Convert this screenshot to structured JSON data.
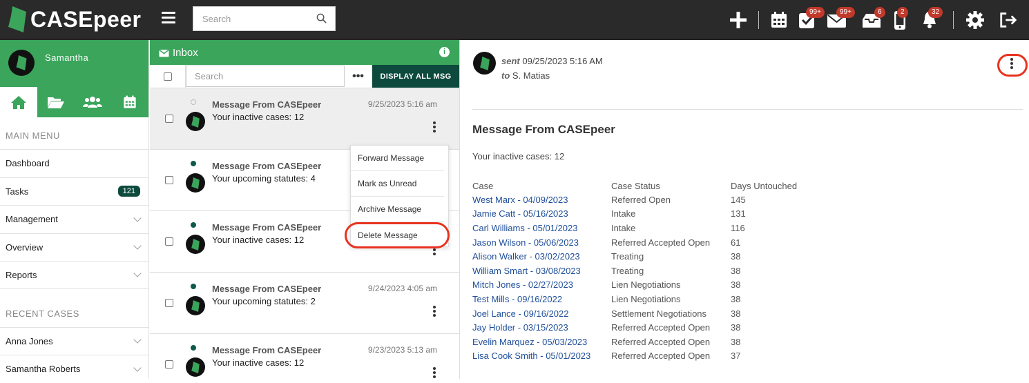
{
  "app": {
    "name": "CASEpeer"
  },
  "search": {
    "placeholder": "Search"
  },
  "topbar": {
    "badges": {
      "tasks": "99+",
      "mail": "99+",
      "inbox": "6",
      "mobile": "2",
      "notifications": "32"
    }
  },
  "sidebar": {
    "user": "Samantha",
    "main_menu_title": "MAIN MENU",
    "items": [
      {
        "label": "Dashboard"
      },
      {
        "label": "Tasks",
        "count": "121"
      },
      {
        "label": "Management"
      },
      {
        "label": "Overview"
      },
      {
        "label": "Reports"
      }
    ],
    "recent_title": "RECENT CASES",
    "recent": [
      {
        "label": "Anna Jones"
      },
      {
        "label": "Samantha Roberts"
      }
    ]
  },
  "inbox": {
    "title": "Inbox",
    "search_placeholder": "Search",
    "more": "•••",
    "display_all": "DISPLAY ALL MSG",
    "messages": [
      {
        "from": "Message From CASEpeer",
        "text": "Your inactive cases: 12",
        "date": "9/25/2023 5:16 am"
      },
      {
        "from": "Message From CASEpeer",
        "text": "Your upcoming statutes: 4",
        "date": ""
      },
      {
        "from": "Message From CASEpeer",
        "text": "Your inactive cases: 12",
        "date": ""
      },
      {
        "from": "Message From CASEpeer",
        "text": "Your upcoming statutes: 2",
        "date": "9/24/2023 4:05 am"
      },
      {
        "from": "Message From CASEpeer",
        "text": "Your inactive cases: 12",
        "date": "9/23/2023 5:13 am"
      }
    ]
  },
  "menu": {
    "forward": "Forward Message",
    "unread": "Mark as Unread",
    "archive": "Archive Message",
    "delete": "Delete Message"
  },
  "detail": {
    "sent_label": "sent",
    "sent_value": "09/25/2023 5:16 AM",
    "to_label": "to",
    "to_value": "S. Matias",
    "title": "Message From CASEpeer",
    "body": "Your inactive cases: 12",
    "columns": [
      "Case",
      "Case Status",
      "Days Untouched"
    ],
    "rows": [
      [
        "West Marx - 04/09/2023",
        "Referred Open",
        "145"
      ],
      [
        "Jamie Catt - 05/16/2023",
        "Intake",
        "131"
      ],
      [
        "Carl Williams - 05/01/2023",
        "Intake",
        "116"
      ],
      [
        "Jason Wilson - 05/06/2023",
        "Referred Accepted Open",
        "61"
      ],
      [
        "Alison Walker - 03/02/2023",
        "Treating",
        "38"
      ],
      [
        "William Smart - 03/08/2023",
        "Treating",
        "38"
      ],
      [
        "Mitch Jones - 02/27/2023",
        "Lien Negotiations",
        "38"
      ],
      [
        "Test Mills - 09/16/2022",
        "Lien Negotiations",
        "38"
      ],
      [
        "Joel Lance - 09/16/2022",
        "Settlement Negotiations",
        "38"
      ],
      [
        "Jay Holder - 03/15/2023",
        "Referred Accepted Open",
        "38"
      ],
      [
        "Evelin Marquez - 05/03/2023",
        "Referred Accepted Open",
        "38"
      ],
      [
        "Lisa Cook Smith - 05/01/2023",
        "Referred Accepted Open",
        "37"
      ]
    ]
  },
  "colors": {
    "brand_green": "#3aa55b",
    "dark_green": "#0d4a3d",
    "topbar": "#2a2a2a",
    "badge_red": "#c0392b",
    "highlight": "#e8321e",
    "link_blue": "#1e4e9a"
  }
}
